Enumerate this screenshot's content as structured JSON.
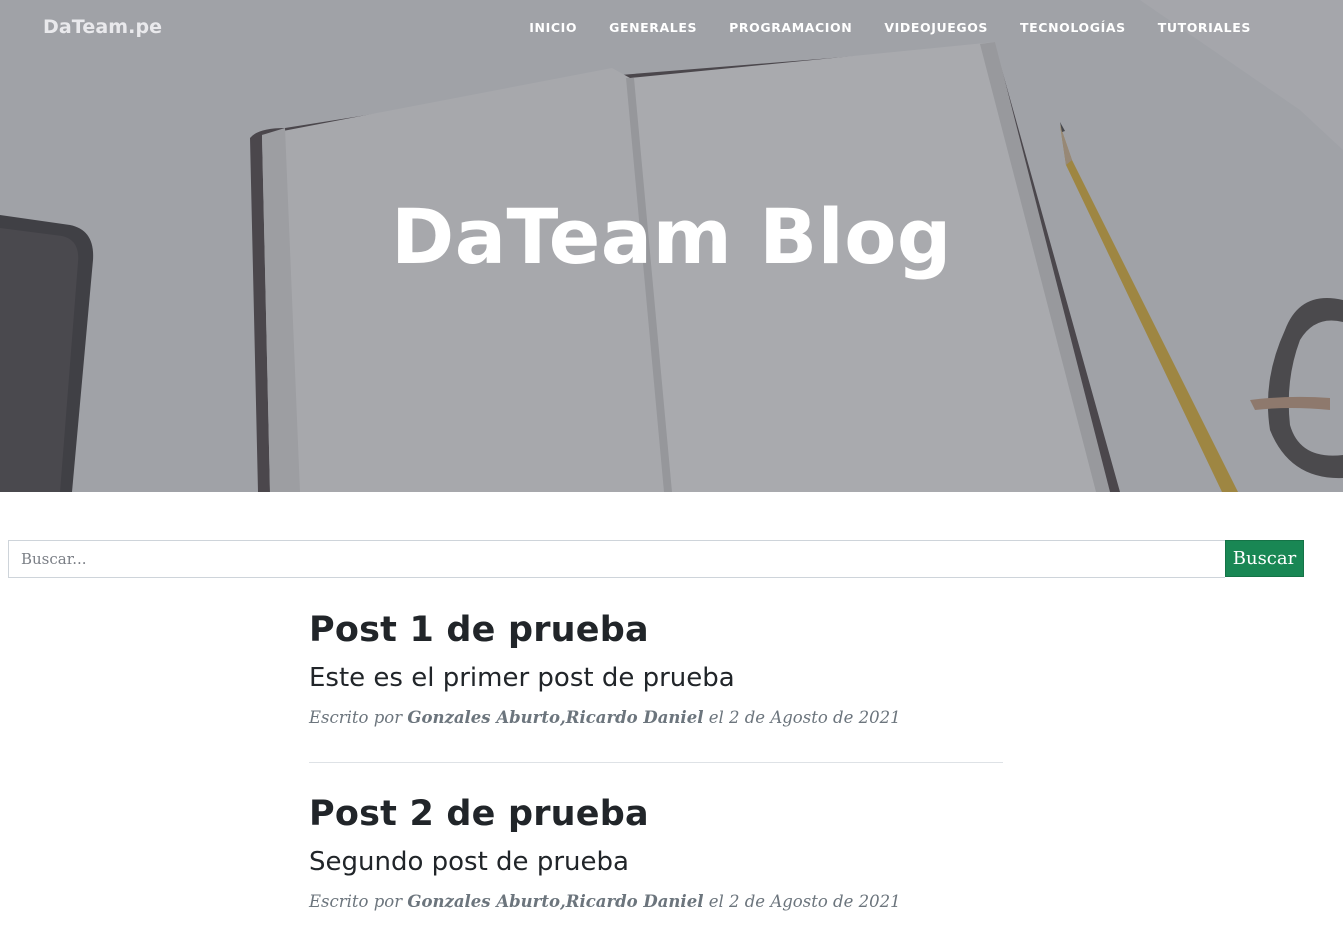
{
  "navbar": {
    "brand": "DaTeam.pe",
    "links": [
      "INICIO",
      "GENERALES",
      "PROGRAMACION",
      "VIDEOJUEGOS",
      "TECNOLOGÍAS",
      "TUTORIALES"
    ]
  },
  "hero": {
    "title": "DaTeam Blog"
  },
  "search": {
    "placeholder": "Buscar...",
    "button_label": "Buscar"
  },
  "posts": [
    {
      "title": "Post 1 de prueba",
      "subtitle": "Este es el primer post de prueba",
      "meta_prefix": "Escrito por",
      "author": "Gonzales Aburto,Ricardo Daniel",
      "meta_suffix": "el 2 de Agosto de 2021"
    },
    {
      "title": "Post 2 de prueba",
      "subtitle": "Segundo post de prueba",
      "meta_prefix": "Escrito por",
      "author": "Gonzales Aburto,Ricardo Daniel",
      "meta_suffix": "el 2 de Agosto de 2021"
    }
  ],
  "colors": {
    "accent_button": "#198754",
    "text_dark": "#212529",
    "meta_text": "#6c757d"
  }
}
